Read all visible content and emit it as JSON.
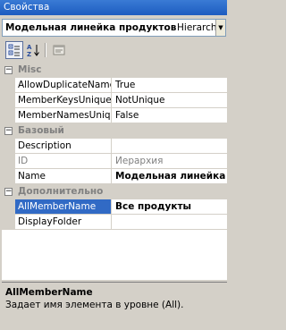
{
  "window": {
    "title": "Свойства"
  },
  "object_selector": {
    "name": "Модельная линейка продуктов",
    "type": "Hierarchy",
    "dropdown_icon": "chevron-down-icon"
  },
  "toolbar": {
    "buttons": [
      {
        "name": "categorized-view",
        "icon": "categorized-icon",
        "active": true
      },
      {
        "name": "alphabetical-view",
        "icon": "sort-az-icon",
        "active": false
      },
      {
        "name": "property-pages",
        "icon": "property-pages-icon",
        "active": false
      }
    ]
  },
  "grid": {
    "categories": [
      {
        "title": "Misc",
        "expanded_symbol": "−",
        "properties": [
          {
            "name": "AllowDuplicateNames",
            "value": "True"
          },
          {
            "name": "MemberKeysUnique",
            "value": "NotUnique"
          },
          {
            "name": "MemberNamesUnique",
            "value": "False"
          }
        ]
      },
      {
        "title": "Базовый",
        "expanded_symbol": "−",
        "properties": [
          {
            "name": "Description",
            "value": ""
          },
          {
            "name": "ID",
            "value": "Иерархия",
            "disabled": true
          },
          {
            "name": "Name",
            "value": "Модельная линейка продуктов",
            "bold": true
          }
        ]
      },
      {
        "title": "Дополнительно",
        "expanded_symbol": "−",
        "properties": [
          {
            "name": "AllMemberName",
            "value": "Все продукты",
            "bold": true,
            "selected": true
          },
          {
            "name": "DisplayFolder",
            "value": ""
          }
        ]
      }
    ]
  },
  "description": {
    "title": "AllMemberName",
    "text": "Задает имя элемента в уровне (All)."
  },
  "colors": {
    "title_bar": "#1d5cc0",
    "selection": "#316ac5",
    "panel": "#d4d0c8",
    "category_text": "#808080"
  }
}
